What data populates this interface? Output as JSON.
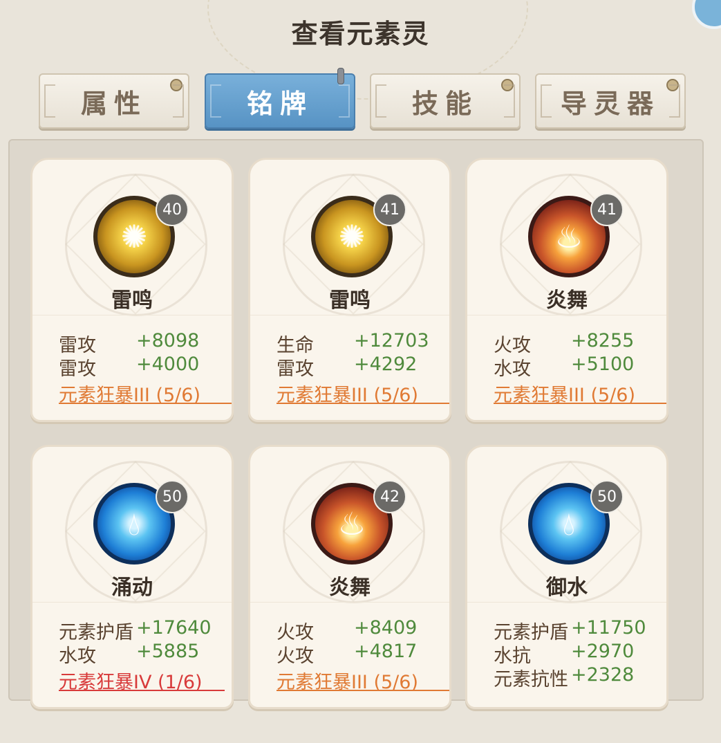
{
  "page_title": "查看元素灵",
  "tabs": [
    {
      "label": "属性",
      "active": false
    },
    {
      "label": "铭牌",
      "active": true
    },
    {
      "label": "技能",
      "active": false
    },
    {
      "label": "导灵器",
      "active": false
    }
  ],
  "colors": {
    "active_tab": "#5d9acb",
    "stat_value": "#4f8a3c",
    "set_bonus_active": "#e07a34",
    "set_bonus_low": "#d83a3a",
    "level_badge": "#6b6a67"
  },
  "cards": [
    {
      "name": "雷鸣",
      "level": "40",
      "element": "thunder",
      "icon": "thunder-orb-icon",
      "stats": [
        {
          "name": "雷攻",
          "value": "+8098"
        },
        {
          "name": "雷攻",
          "value": "+4000"
        }
      ],
      "set_bonus": "元素狂暴III  (5/6)",
      "set_style": "orange"
    },
    {
      "name": "雷鸣",
      "level": "41",
      "element": "thunder",
      "icon": "thunder-orb-icon",
      "stats": [
        {
          "name": "生命",
          "value": "+12703"
        },
        {
          "name": "雷攻",
          "value": "+4292"
        }
      ],
      "set_bonus": "元素狂暴III  (5/6)",
      "set_style": "orange"
    },
    {
      "name": "炎舞",
      "level": "41",
      "element": "fire",
      "icon": "fire-orb-icon",
      "stats": [
        {
          "name": "火攻",
          "value": "+8255"
        },
        {
          "name": "水攻",
          "value": "+5100"
        }
      ],
      "set_bonus": "元素狂暴III  (5/6)",
      "set_style": "orange"
    },
    {
      "name": "涌动",
      "level": "50",
      "element": "water",
      "icon": "water-orb-icon",
      "stats": [
        {
          "name": "元素护盾",
          "value": "+17640"
        },
        {
          "name": "水攻",
          "value": "+5885"
        }
      ],
      "set_bonus": "元素狂暴IV  (1/6)",
      "set_style": "red"
    },
    {
      "name": "炎舞",
      "level": "42",
      "element": "fire",
      "icon": "fire-orb-icon",
      "stats": [
        {
          "name": "火攻",
          "value": "+8409"
        },
        {
          "name": "火攻",
          "value": "+4817"
        }
      ],
      "set_bonus": "元素狂暴III  (5/6)",
      "set_style": "orange"
    },
    {
      "name": "御水",
      "level": "50",
      "element": "water",
      "icon": "water-orb-icon",
      "stats": [
        {
          "name": "元素护盾",
          "value": "+11750"
        },
        {
          "name": "水抗",
          "value": "+2970"
        },
        {
          "name": "元素抗性",
          "value": "+2328"
        }
      ],
      "set_bonus": "",
      "set_style": "none"
    }
  ]
}
